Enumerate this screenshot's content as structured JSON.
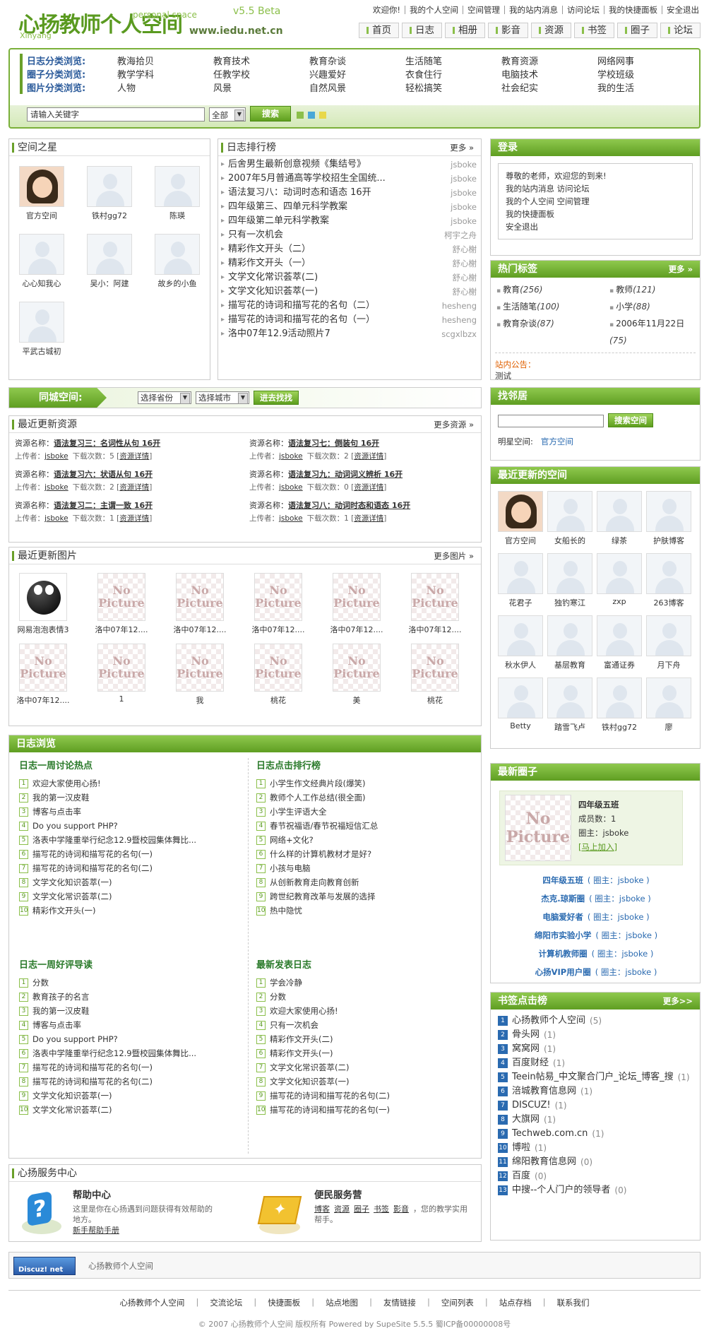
{
  "header": {
    "logo_cn": "心扬教师个人空间",
    "logo_en": "Xinyang",
    "logo_ps": "personal space",
    "version": "v5.5 Beta",
    "site": "www.iedu.net.cn",
    "toplinks": [
      "欢迎你!",
      "我的个人空间",
      "空间管理",
      "我的站内消息",
      "访问论坛",
      "我的快捷面板",
      "安全退出"
    ],
    "nav": [
      "首页",
      "日志",
      "相册",
      "影音",
      "资源",
      "书签",
      "圈子",
      "论坛"
    ]
  },
  "categories": {
    "rows": [
      {
        "label": "日志分类浏览:",
        "items": [
          "教海拾贝",
          "教育技术",
          "教育杂谈",
          "生活随笔",
          "教育资源",
          "网络网事"
        ]
      },
      {
        "label": "圈子分类浏览:",
        "items": [
          "教学学科",
          "任教学校",
          "兴趣爱好",
          "衣食住行",
          "电脑技术",
          "学校班级"
        ]
      },
      {
        "label": "图片分类浏览:",
        "items": [
          "人物",
          "风景",
          "自然风景",
          "轻松搞笑",
          "社会纪实",
          "我的生活"
        ]
      }
    ],
    "search_placeholder": "请输入关键字",
    "scope": "全部",
    "search_btn": "搜索"
  },
  "stars": {
    "title": "空间之星",
    "items": [
      "官方空间",
      "铁村gg72",
      "陈瑛",
      "心心知我心",
      "吴小：阿建",
      "故乡的小鱼",
      "平武古城初"
    ]
  },
  "ranking": {
    "title": "日志排行榜",
    "more": "更多 »",
    "items": [
      [
        "后舍男生最新创意视频《集结号》",
        "jsboke"
      ],
      [
        "2007年5月普通高等学校招生全国统...",
        "jsboke"
      ],
      [
        "语法复习八：动词时态和语态 16开",
        "jsboke"
      ],
      [
        "四年级第三、四单元科学教案",
        "jsboke"
      ],
      [
        "四年级第二单元科学教案",
        "jsboke"
      ],
      [
        "只有一次机会",
        "柯宇之舟"
      ],
      [
        "精彩作文开头（二）",
        "舒心榭"
      ],
      [
        "精彩作文开头（一）",
        "舒心榭"
      ],
      [
        "文学文化常识荟萃(二)",
        "舒心榭"
      ],
      [
        "文学文化知识荟萃(一)",
        "舒心榭"
      ],
      [
        "描写花的诗词和描写花的名句（二）",
        "hesheng"
      ],
      [
        "描写花的诗词和描写花的名句（一）",
        "hesheng"
      ],
      [
        "洛中07年12.9活动照片7",
        "scgxlbzx"
      ]
    ]
  },
  "login": {
    "title": "登录",
    "lines": [
      "尊敬的老师，欢迎您的到来!",
      "我的站内消息 访问论坛",
      "我的个人空间 空间管理",
      "我的快捷面板",
      "安全退出"
    ]
  },
  "tags": {
    "title": "热门标签",
    "more": "更多 »",
    "items": [
      [
        "教育",
        "(256)"
      ],
      [
        "教师",
        "(121)"
      ],
      [
        "生活随笔",
        "(100)"
      ],
      [
        "小学",
        "(88)"
      ],
      [
        "教育杂谈",
        "(87)"
      ],
      [
        "2006年11月22日",
        "(75)"
      ]
    ],
    "notice_label": "站内公告：",
    "notice": "测试"
  },
  "local": {
    "label": "同城空间:",
    "province": "选择省份",
    "city": "选择城市",
    "btn": "进去找找"
  },
  "neighbor": {
    "title": "找邻居",
    "btn": "搜索空间",
    "star_label": "明星空间:",
    "star_link": "官方空间"
  },
  "resources": {
    "title": "最近更新资源",
    "more": "更多资源 »",
    "name_label": "资源名称：",
    "uploader_label": "上传者：",
    "dl_label": "下载次数：",
    "detail": "资源详情",
    "items": [
      [
        "语法复习三：名词性从句 16开",
        "jsboke",
        "5"
      ],
      [
        "语法复习七：倒装句 16开",
        "jsboke",
        "2"
      ],
      [
        "语法复习六：状语从句 16开",
        "jsboke",
        "2"
      ],
      [
        "语法复习九：动词词义辨析 16开",
        "jsboke",
        "0"
      ],
      [
        "语法复习二：主谓一致 16开",
        "jsboke",
        "1"
      ],
      [
        "语法复习八：动词时态和语态 16开",
        "jsboke",
        "1"
      ]
    ]
  },
  "pictures": {
    "title": "最近更新图片",
    "more": "更多图片 »",
    "nopic": "No Picture",
    "items": [
      "网易泡泡表情3",
      "洛中07年12....",
      "洛中07年12....",
      "洛中07年12....",
      "洛中07年12....",
      "洛中07年12....",
      "洛中07年12....",
      "1",
      "我",
      "桃花",
      "美",
      "桃花"
    ]
  },
  "spaces": {
    "title": "最近更新的空间",
    "items": [
      "官方空间",
      "女船长的",
      "绿茶",
      "护肤博客",
      "花君子",
      "独钓寒江",
      "zxp",
      "263博客",
      "秋水伊人",
      "基层教育",
      "富通证券",
      "月下舟",
      "Betty",
      "踏雪飞卢",
      "铁村gg72",
      "廖"
    ]
  },
  "blogbrowse": {
    "title": "日志浏览",
    "hot": {
      "title": "日志一周讨论热点",
      "items": [
        "欢迎大家使用心扬!",
        "我的第一汉皮鞋",
        "博客与点击率",
        "Do you support PHP?",
        "洛表中学隆重举行纪念12.9暨校园集体舞比...",
        "描写花的诗词和描写花的名句(一)",
        "描写花的诗词和描写花的名句(二)",
        "文学文化知识荟萃(一)",
        "文学文化常识荟萃(二)",
        "精彩作文开头(一)"
      ]
    },
    "click": {
      "title": "日志点击排行榜",
      "items": [
        "小学生作文经典片段(爆笑)",
        "教师个人工作总结(很全面)",
        "小学生评语大全",
        "春节祝福语/春节祝福短信汇总",
        "网络+文化?",
        "什么样的计算机教材才是好?",
        "小孩与电脑",
        "从创新教育走向教育创新",
        "跨世纪教育改革与发展的选择",
        "热中隐忧"
      ]
    },
    "good": {
      "title": "日志一周好评导读",
      "items": [
        "分数",
        "教育孩子的名言",
        "我的第一汉皮鞋",
        "博客与点击率",
        "Do you support PHP?",
        "洛表中学隆重举行纪念12.9暨校园集体舞比...",
        "描写花的诗词和描写花的名句(一)",
        "描写花的诗词和描写花的名句(二)",
        "文学文化知识荟萃(一)",
        "文学文化常识荟萃(二)"
      ]
    },
    "latest": {
      "title": "最新发表日志",
      "items": [
        "学会冷静",
        "分数",
        "欢迎大家使用心扬!",
        "只有一次机会",
        "精彩作文开头(二)",
        "精彩作文开头(一)",
        "文学文化常识荟萃(二)",
        "文学文化知识荟萃(一)",
        "描写花的诗词和描写花的名句(二)",
        "描写花的诗词和描写花的名句(一)"
      ]
    }
  },
  "groups": {
    "title": "最新圈子",
    "name": "四年级五班",
    "members": "成员数：1",
    "owner": "圈主：jsboke",
    "join": "[马上加入]",
    "list": [
      [
        "四年级五班",
        "( 圈主：jsboke )"
      ],
      [
        "杰克.琼斯圈",
        "( 圈主：jsboke )"
      ],
      [
        "电脑爱好者",
        "( 圈主：jsboke )"
      ],
      [
        "绵阳市实验小学",
        "( 圈主：jsboke )"
      ],
      [
        "计算机教师圈",
        "( 圈主：jsboke )"
      ],
      [
        "心扬VIP用户圈",
        "( 圈主：jsboke )"
      ]
    ]
  },
  "bookmarks": {
    "title": "书签点击榜",
    "more": "更多>>",
    "items": [
      [
        "心扬教师个人空间",
        "(5)"
      ],
      [
        "骨头网",
        "(1)"
      ],
      [
        "窝窝网",
        "(1)"
      ],
      [
        "百度财经",
        "(1)"
      ],
      [
        "Teein帖易_中文聚合门户_论坛_博客_搜",
        "(1)"
      ],
      [
        "涪城教育信息网",
        "(1)"
      ],
      [
        "DISCUZ!",
        "(1)"
      ],
      [
        "大旗网",
        "(1)"
      ],
      [
        "Techweb.com.cn",
        "(1)"
      ],
      [
        "博啦",
        "(1)"
      ],
      [
        "绵阳教育信息网",
        "(0)"
      ],
      [
        "百度",
        "(0)"
      ],
      [
        "中搜--个人门户的领导者",
        "(0)"
      ]
    ]
  },
  "service": {
    "title": "心扬服务中心",
    "help_title": "帮助中心",
    "help_desc": "这里是你在心扬遇到问题获得有效帮助的地方。",
    "help_link": "新手帮助手册",
    "conv_title": "便民服务营",
    "conv_links": [
      "博客",
      "资源",
      "圈子",
      "书签",
      "影音"
    ],
    "conv_desc": "，您的教学实用帮手。"
  },
  "footer": {
    "badge": "Discuz! net",
    "sitename": "心扬教师个人空间",
    "links": [
      "心扬教师个人空间",
      "交流论坛",
      "快捷面板",
      "站点地图",
      "友情链接",
      "空间列表",
      "站点存档",
      "联系我们"
    ],
    "copyright": "© 2007 心扬教师个人空间 版权所有 Powered by SupeSite 5.5.5 蜀ICP备00000008号"
  },
  "colors": {
    "accent": "#6aa02a",
    "link_blue": "#2a6ab0"
  }
}
